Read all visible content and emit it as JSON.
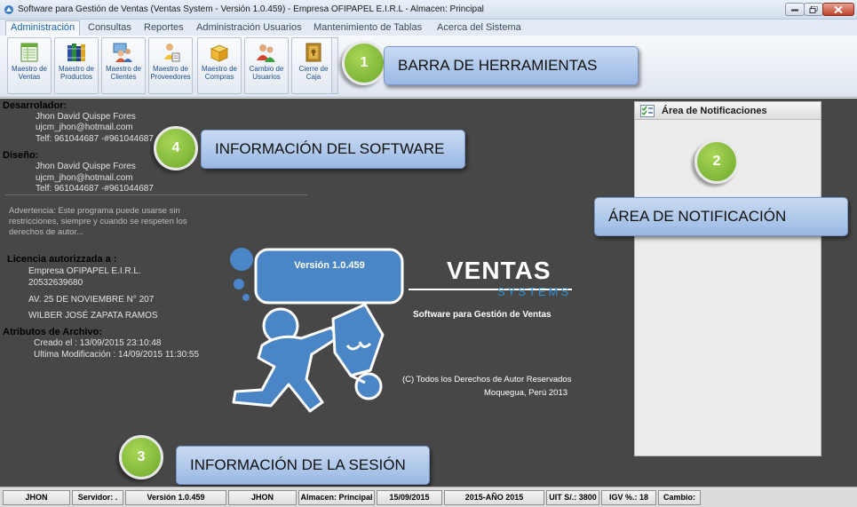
{
  "window": {
    "title": "Software para Gestión de Ventas (Ventas System - Versión 1.0.459) - Empresa OFIPAPEL E.I.R.L - Almacen: Principal"
  },
  "menu": {
    "tabs": [
      {
        "label": "Administración",
        "active": true
      },
      {
        "label": "Consultas"
      },
      {
        "label": "Reportes"
      },
      {
        "label": "Administración Usuarios"
      },
      {
        "label": "Mantenimiento de Tablas"
      },
      {
        "label": "Acerca del Sistema"
      }
    ]
  },
  "ribbon": {
    "buttons": [
      {
        "line1": "Maestro de",
        "line2": "Ventas",
        "icon": "sales-sheet-icon"
      },
      {
        "line1": "Maestro de",
        "line2": "Productos",
        "icon": "books-icon"
      },
      {
        "line1": "Maestro de",
        "line2": "Clientes",
        "icon": "clients-icon"
      },
      {
        "line1": "Maestro de",
        "line2": "Proveedores",
        "icon": "suppliers-icon"
      },
      {
        "line1": "Maestro de",
        "line2": "Compras",
        "icon": "box-icon"
      },
      {
        "line1": "Cambio de",
        "line2": "Usuarios",
        "icon": "users-icon"
      },
      {
        "line1": "Cierre de",
        "line2": "Caja",
        "icon": "cash-box-icon"
      }
    ]
  },
  "info": {
    "developer_heading": "Desarrolador:",
    "developer_name": "Jhon  David Quispe Fores",
    "developer_email": "ujcm_jhon@hotmail.com",
    "developer_phone": "Telf: 961044687 -#961044687",
    "design_heading": "Diseño:",
    "design_name": "Jhon  David Quispe Fores",
    "design_email": "ujcm_jhon@hotmail.com",
    "design_phone": "Telf: 961044687 -#961044687",
    "warning": "Advertencia: Este programa puede usarse sin restricciones, siempre y cuando se respeten los derechos de autor...",
    "license_heading": "Licencia autorizzada a :",
    "license_company": "Empresa OFIPAPEL E.I.R.L.",
    "license_ruc": "20532639680",
    "license_address": "AV. 25 DE NOVIEMBRE N° 207",
    "license_owner": "WILBER JOSÉ ZAPATA RAMOS",
    "file_heading": "Atributos de Archivo:",
    "file_created": "Creado el : 13/09/2015 23:10:48",
    "file_modified": "Ultima Modificación : 14/09/2015 11:30:55"
  },
  "notifications": {
    "title": "Área de Notificaciones"
  },
  "callouts": [
    {
      "number": "1",
      "label": "BARRA DE HERRAMIENTAS"
    },
    {
      "number": "2",
      "label": "ÁREA DE NOTIFICACIÓN"
    },
    {
      "number": "3",
      "label": "INFORMACIÓN DE LA SESIÓN"
    },
    {
      "number": "4",
      "label": "INFORMACIÓN DEL SOFTWARE"
    }
  ],
  "brand": {
    "version": "Versión 1.0.459",
    "name": "VENTAS",
    "systems": "SYSTEMS",
    "subtitle": "Software para Gestión de Ventas",
    "copyright": "(C) Todos los Derechos de Autor Reservados",
    "location": "Moquegua, Perú 2013"
  },
  "status": {
    "user": "JHON",
    "server": "Servidor: .",
    "version": "Versión 1.0.459",
    "user2": "JHON",
    "almacen": "Almacen: Principal",
    "date": "15/09/2015",
    "year": "2015-AÑO 2015",
    "uit": "UIT S/.: 3800",
    "igv": "IGV %.: 18",
    "cambio": "Cambio:"
  },
  "colors": {
    "main_bg": "#474747",
    "callout_green": "#7cb832",
    "callout_box": "#b3cbeb",
    "logo_blue": "#4a86c5"
  }
}
